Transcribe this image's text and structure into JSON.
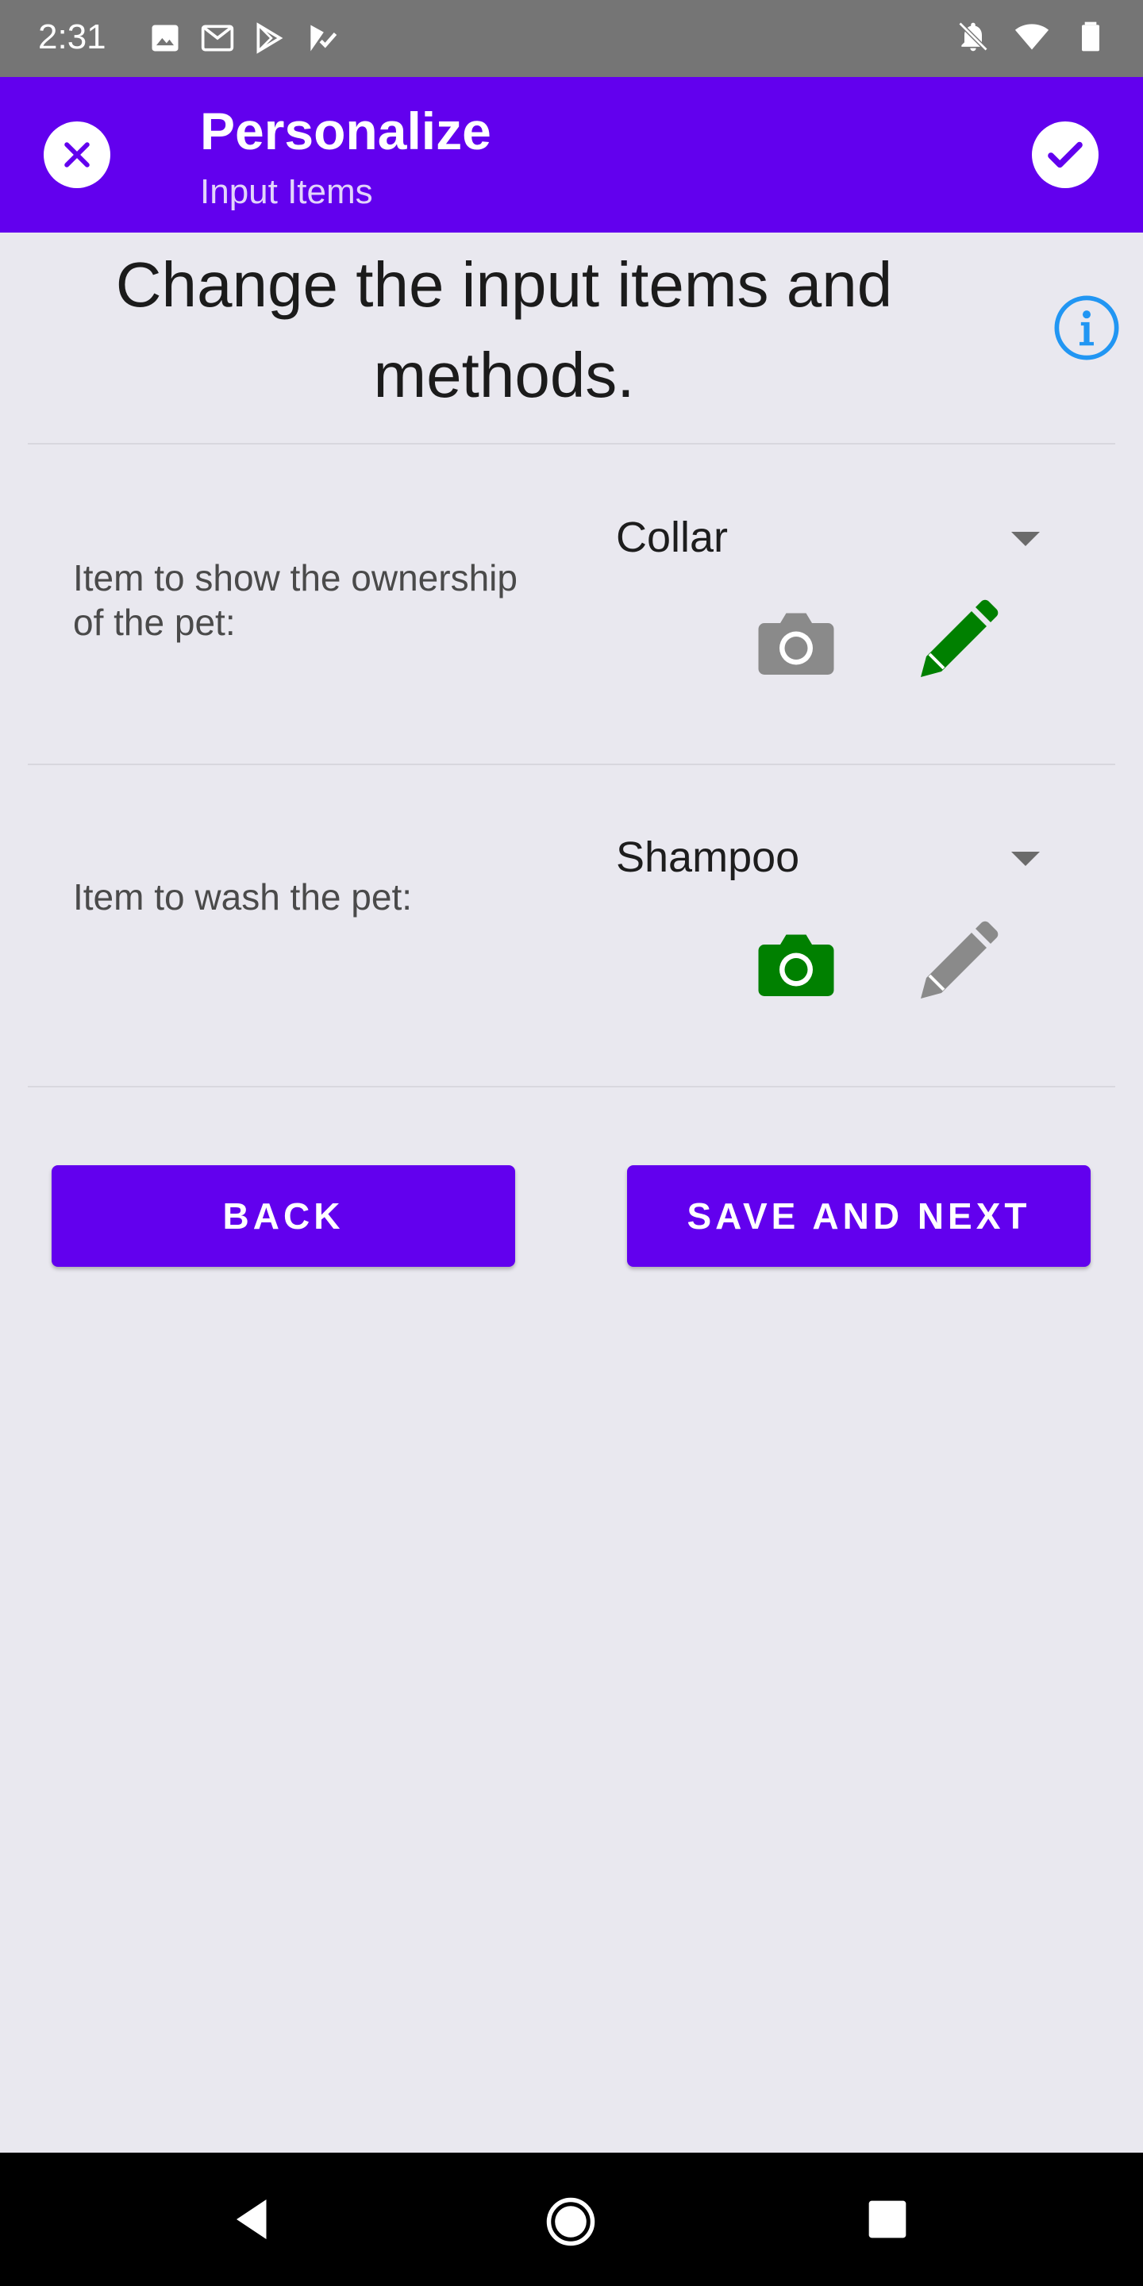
{
  "status_bar": {
    "time": "2:31",
    "left_icons": [
      "image-icon",
      "gmail-icon",
      "play-store-icon",
      "play-store-check-icon"
    ],
    "right_icons": [
      "notifications-off-icon",
      "wifi-icon",
      "battery-icon"
    ]
  },
  "app_bar": {
    "title": "Personalize",
    "subtitle": "Input Items",
    "close_icon": "close-icon",
    "confirm_icon": "check-icon",
    "color": "#6200ee"
  },
  "heading": {
    "line1": "Change the input items and",
    "line2": "methods."
  },
  "items": [
    {
      "label_line1": "Item to show the ownership",
      "label_line2": "of the pet:",
      "selected": "Collar",
      "camera_active": false,
      "pencil_active": true
    },
    {
      "label_line1": "Item to wash the pet:",
      "selected": "Shampoo",
      "camera_active": true,
      "pencil_active": false
    }
  ],
  "colors": {
    "active": "#008000",
    "inactive": "#8a8a8a",
    "accent": "#6200ee",
    "info": "#2196f3"
  },
  "buttons": {
    "back": "BACK",
    "save_next": "SAVE AND NEXT"
  }
}
